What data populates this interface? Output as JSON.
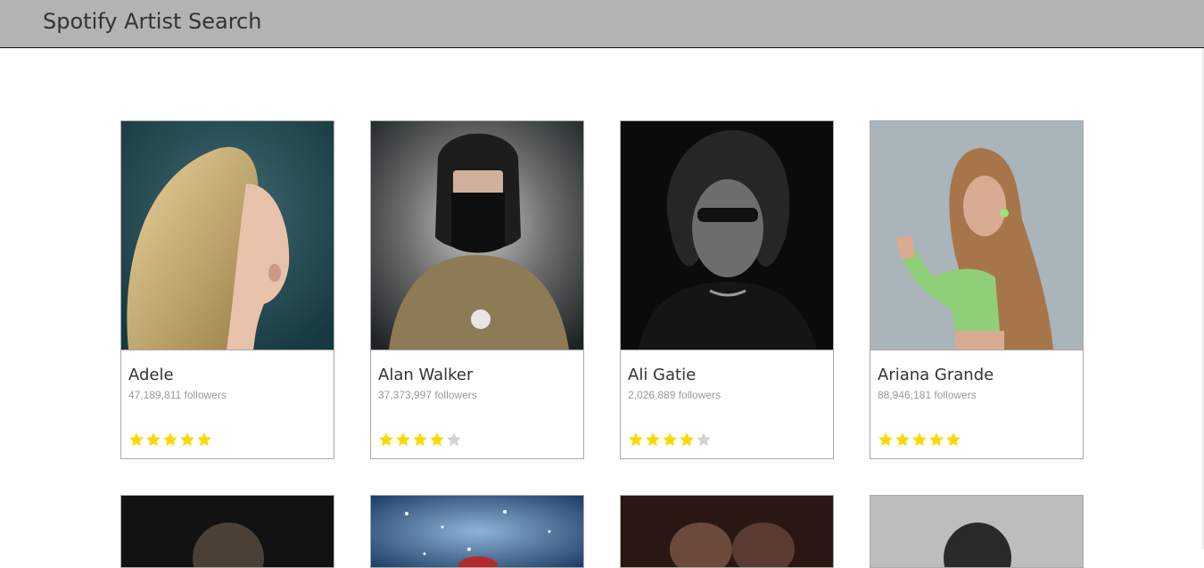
{
  "app": {
    "title": "Spotify Artist Search"
  },
  "colors": {
    "header_bg": "#b3b3b3",
    "star_on": "#ffd700",
    "star_off": "#d3d3d3"
  },
  "artists": [
    {
      "name": "Adele",
      "followers": "47,189,811 followers",
      "rating": 5
    },
    {
      "name": "Alan Walker",
      "followers": "37,373,997 followers",
      "rating": 4
    },
    {
      "name": "Ali Gatie",
      "followers": "2,026,889 followers",
      "rating": 4
    },
    {
      "name": "Ariana Grande",
      "followers": "88,946,181 followers",
      "rating": 5
    }
  ]
}
